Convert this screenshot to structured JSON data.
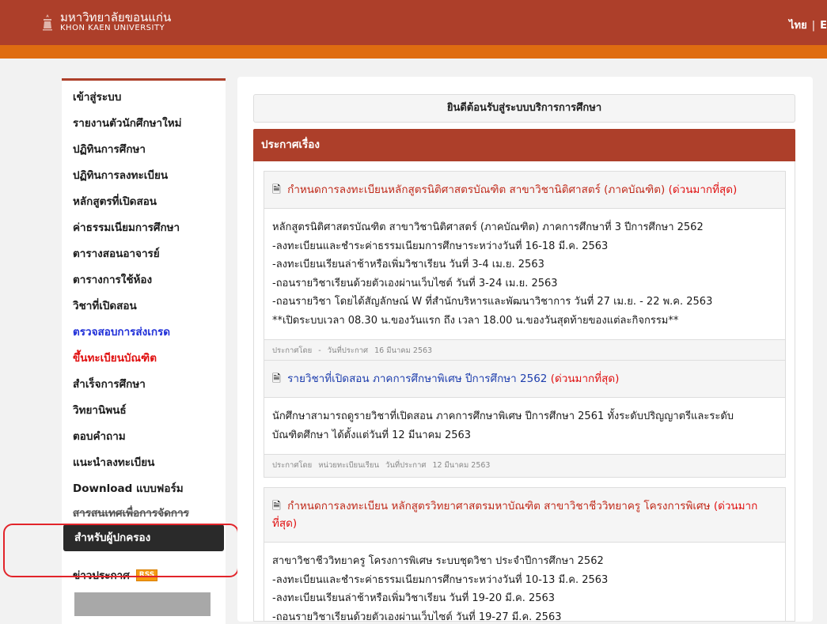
{
  "header": {
    "logo_th": "มหาวิทยาลัยขอนแก่น",
    "logo_en": "KHON KAEN UNIVERSITY",
    "lang_th": "ไทย",
    "lang_sep": "|",
    "lang_en": "E",
    "brand_color": "#ad3f2a",
    "accent_color": "#df6c10"
  },
  "sidebar": {
    "items": [
      {
        "label": "เข้าสู่ระบบ"
      },
      {
        "label": "รายงานตัวนักศึกษาใหม่"
      },
      {
        "label": "ปฏิทินการศึกษา"
      },
      {
        "label": "ปฏิทินการลงทะเบียน"
      },
      {
        "label": "หลักสูตรที่เปิดสอน"
      },
      {
        "label": "ค่าธรรมเนียมการศึกษา"
      },
      {
        "label": "ตารางสอนอาจารย์"
      },
      {
        "label": "ตารางการใช้ห้อง"
      },
      {
        "label": "วิชาที่เปิดสอน"
      },
      {
        "label": "ตรวจสอบการส่งเกรด"
      },
      {
        "label": "ขึ้นทะเบียนบัณฑิต"
      },
      {
        "label": "สำเร็จการศึกษา"
      },
      {
        "label": "วิทยานิพนธ์"
      },
      {
        "label": "ตอบคำถาม"
      },
      {
        "label": "แนะนำลงทะเบียน"
      },
      {
        "label": "Download แบบฟอร์ม"
      },
      {
        "label": "สารสนเทศเพื่อการจัดการ"
      },
      {
        "label": "สำหรับผู้ปกครอง"
      }
    ],
    "news_label": "ข่าวประกาศ",
    "rss_label": "RSS"
  },
  "main": {
    "welcome": "ยินดีต้อนรับสู่ระบบบริการการศึกษา",
    "announce_title": "ประกาศเรื่อง",
    "cards": [
      {
        "title": "กำหนดการลงทะเบียนหลักสูตรนิติศาสตรบัณฑิต สาขาวิชานิติศาสตร์ (ภาคบัณฑิต)",
        "urgent": "(ด่วนมากที่สุด)",
        "lines": [
          "หลักสูตรนิติศาสตรบัณฑิต สาขาวิชานิติศาสตร์ (ภาคบัณฑิต) ภาคการศึกษาที่ 3 ปีการศึกษา 2562",
          "-ลงทะเบียนและชำระค่าธรรมเนียมการศึกษาระหว่างวันที่ 16-18 มี.ค. 2563",
          "-ลงทะเบียนเรียนล่าช้าหรือเพิ่มวิชาเรียน วันที่ 3-4 เม.ย. 2563",
          "-ถอนรายวิชาเรียนด้วยตัวเองผ่านเว็บไซต์ วันที่ 3-24 เม.ย. 2563",
          "-ถอนรายวิชา โดยได้สัญลักษณ์ W ที่สำนักบริหารและพัฒนาวิชาการ วันที่ 27 เม.ย. - 22 พ.ค. 2563",
          "**เปิดระบบเวลา 08.30 น.ของวันแรก ถึง เวลา 18.00 น.ของวันสุดท้ายของแต่ละกิจกรรม**"
        ],
        "foot_by": "ประกาศโดย",
        "foot_unit": "-",
        "foot_date_label": "วันที่ประกาศ",
        "foot_date": "16 มีนาคม 2563"
      },
      {
        "title": "รายวิชาที่เปิดสอน ภาคการศึกษาพิเศษ ปีการศึกษา 2562",
        "urgent": "(ด่วนมากที่สุด)",
        "lines": [
          "นักศึกษาสามารถดูรายวิชาที่เปิดสอน ภาคการศึกษาพิเศษ ปีการศึกษา 2561 ทั้งระดับปริญญาตรีและระดับ",
          "บัณฑิตศึกษา ได้ตั้งแต่วันที่ 12 มีนาคม 2563"
        ],
        "foot_by": "ประกาศโดย",
        "foot_unit": "หน่วยทะเบียนเรียน",
        "foot_date_label": "วันที่ประกาศ",
        "foot_date": "12 มีนาคม 2563"
      },
      {
        "title": "กำหนดการลงทะเบียน หลักสูตรวิทยาศาสตรมหาบัณฑิต สาขาวิชาชีววิทยาครู โครงการพิเศษ",
        "urgent": "(ด่วนมากที่สุด)",
        "lines": [
          "สาขาวิชาชีววิทยาครู โครงการพิเศษ ระบบชุดวิชา ประจำปีการศึกษา 2562",
          "-ลงทะเบียนและชำระค่าธรรมเนียมการศึกษาระหว่างวันที่ 10-13 มี.ค. 2563",
          "-ลงทะเบียนเรียนล่าช้าหรือเพิ่มวิชาเรียน วันที่ 19-20 มี.ค. 2563",
          "-ถอนรายวิชาเรียนด้วยตัวเองผ่านเว็บไซต์ วันที่ 19-27 มี.ค. 2563"
        ]
      }
    ]
  }
}
